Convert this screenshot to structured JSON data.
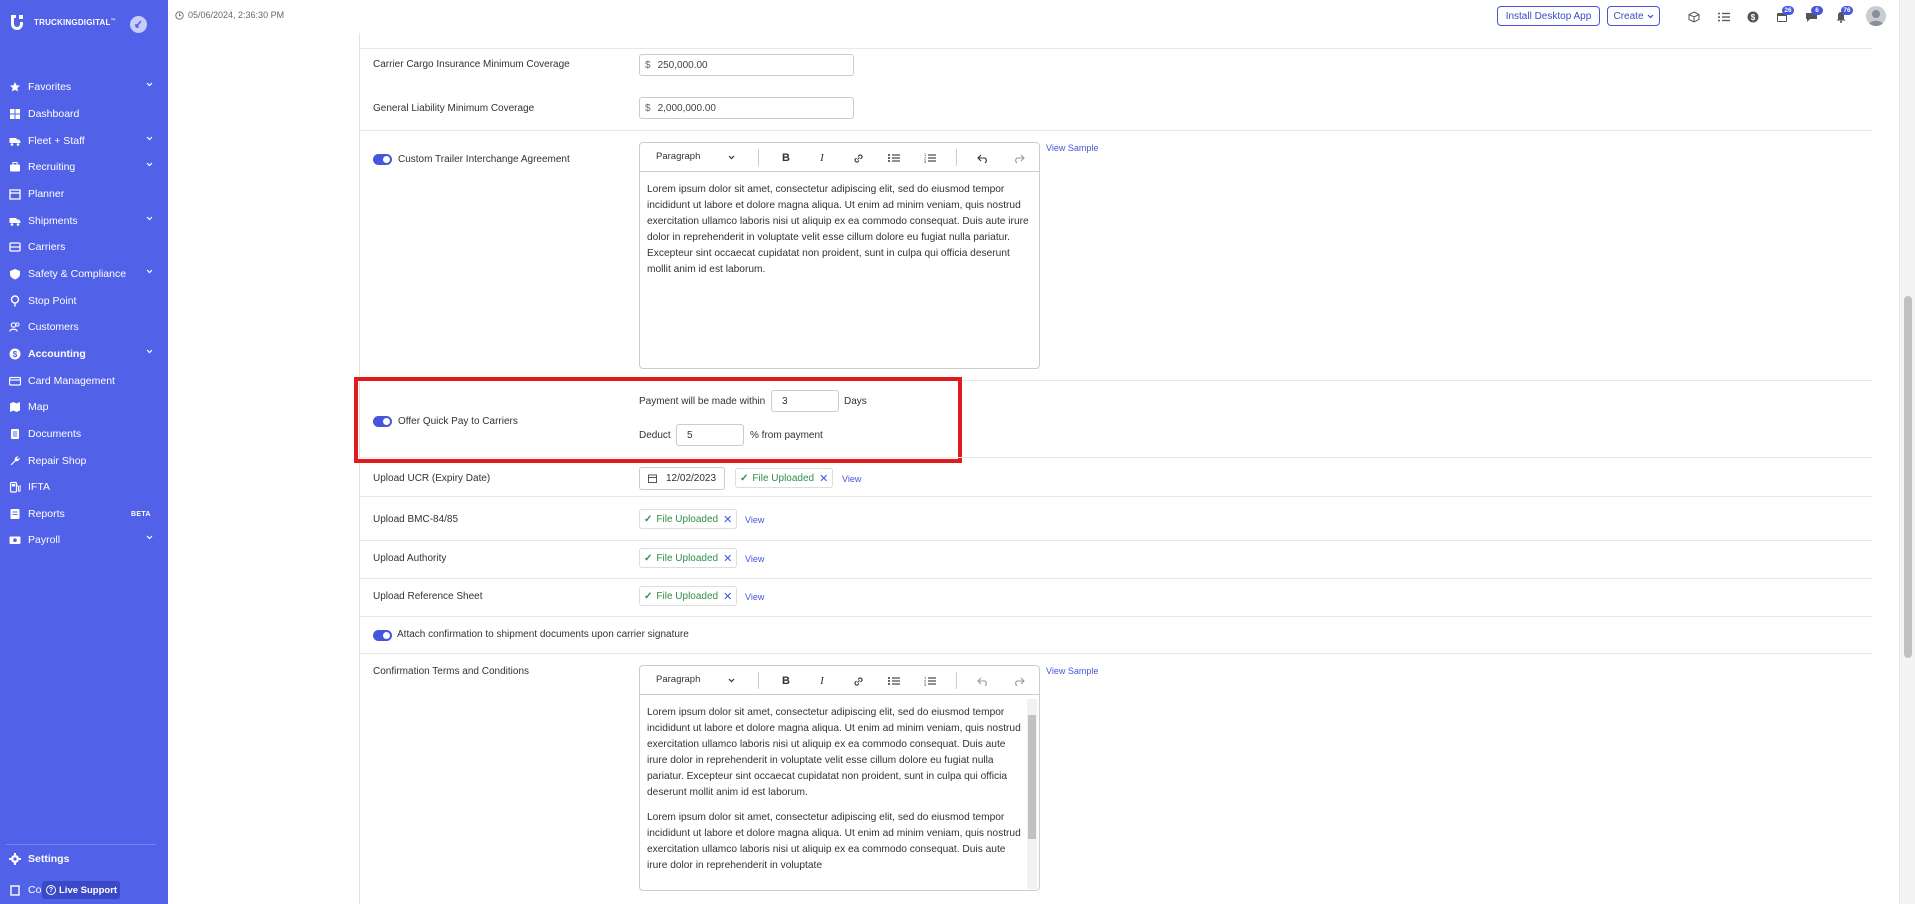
{
  "app": {
    "brand": "TRUCKINGDIGITAL",
    "brand_tm": "™"
  },
  "header": {
    "datetime": "05/06/2024, 2:36:30 PM",
    "install_label": "Install Desktop App",
    "create_label": "Create",
    "badges": {
      "calendar": "26",
      "chat": "6",
      "bell": "76"
    }
  },
  "sidebar": {
    "items": [
      {
        "label": "Favorites",
        "icon": "star-icon",
        "chevron": true
      },
      {
        "label": "Dashboard",
        "icon": "dashboard-icon",
        "chevron": false
      },
      {
        "label": "Fleet + Staff",
        "icon": "truck-icon",
        "chevron": true
      },
      {
        "label": "Recruiting",
        "icon": "briefcase-icon",
        "chevron": true
      },
      {
        "label": "Planner",
        "icon": "planner-icon",
        "chevron": false
      },
      {
        "label": "Shipments",
        "icon": "shipment-icon",
        "chevron": true
      },
      {
        "label": "Carriers",
        "icon": "carrier-icon",
        "chevron": false
      },
      {
        "label": "Safety & Compliance",
        "icon": "shield-icon",
        "chevron": true
      },
      {
        "label": "Stop Point",
        "icon": "pin-icon",
        "chevron": false
      },
      {
        "label": "Customers",
        "icon": "users-icon",
        "chevron": false
      },
      {
        "label": "Accounting",
        "icon": "dollar-icon",
        "chevron": true,
        "active": true
      },
      {
        "label": "Card Management",
        "icon": "card-icon",
        "chevron": false
      },
      {
        "label": "Map",
        "icon": "map-icon",
        "chevron": false
      },
      {
        "label": "Documents",
        "icon": "document-icon",
        "chevron": false
      },
      {
        "label": "Repair Shop",
        "icon": "wrench-icon",
        "chevron": false
      },
      {
        "label": "IFTA",
        "icon": "fuel-icon",
        "chevron": false
      },
      {
        "label": "Reports",
        "icon": "reports-icon",
        "chevron": false,
        "badge": "BETA"
      },
      {
        "label": "Payroll",
        "icon": "payroll-icon",
        "chevron": true
      }
    ],
    "settings_label": "Settings",
    "bottom_partial_label": "Co",
    "live_support_label": "Live Support"
  },
  "form": {
    "cargo": {
      "label": "Carrier Cargo Insurance Minimum Coverage",
      "currency": "$",
      "value": "250,000.00"
    },
    "liability": {
      "label": "General Liability Minimum Coverage",
      "currency": "$",
      "value": "2,000,000.00"
    },
    "trailer": {
      "label": "Custom Trailer Interchange Agreement",
      "enabled": true,
      "format": "Paragraph",
      "view_sample": "View Sample",
      "text": "Lorem ipsum dolor sit amet, consectetur adipiscing elit, sed do eiusmod tempor incididunt ut labore et dolore magna aliqua. Ut enim ad minim veniam, quis nostrud exercitation ullamco laboris nisi ut aliquip ex ea commodo consequat. Duis aute irure dolor in reprehenderit in voluptate velit esse cillum dolore eu fugiat nulla pariatur. Excepteur sint occaecat cupidatat non proident, sunt in culpa qui officia deserunt mollit anim id est laborum."
    },
    "quickpay": {
      "label": "Offer Quick Pay to Carriers",
      "enabled": true,
      "payment_prefix": "Payment will be made within",
      "days_value": "3",
      "days_suffix": "Days",
      "deduct_prefix": "Deduct",
      "deduct_value": "5",
      "deduct_suffix": "% from payment"
    },
    "ucr": {
      "label": "Upload UCR (Expiry Date)",
      "date": "12/02/2023",
      "chip": "File Uploaded",
      "view": "View"
    },
    "bmc": {
      "label": "Upload BMC-84/85",
      "chip": "File Uploaded",
      "view": "View"
    },
    "authority": {
      "label": "Upload Authority",
      "chip": "File Uploaded",
      "view": "View"
    },
    "reference": {
      "label": "Upload Reference Sheet",
      "chip": "File Uploaded",
      "view": "View"
    },
    "attach": {
      "label": "Attach confirmation to shipment documents upon carrier signature",
      "enabled": true
    },
    "terms": {
      "label": "Confirmation Terms and Conditions",
      "format": "Paragraph",
      "view_sample": "View Sample",
      "para1": "Lorem ipsum dolor sit amet, consectetur adipiscing elit, sed do eiusmod tempor incididunt ut labore et dolore magna aliqua. Ut enim ad minim veniam, quis nostrud exercitation ullamco laboris nisi ut aliquip ex ea commodo consequat. Duis aute irure dolor in reprehenderit in voluptate velit esse cillum dolore eu fugiat nulla pariatur. Excepteur sint occaecat cupidatat non proident, sunt in culpa qui officia deserunt mollit anim id est laborum.",
      "para2": "Lorem ipsum dolor sit amet, consectetur adipiscing elit, sed do eiusmod tempor incididunt ut labore et dolore magna aliqua. Ut enim ad minim veniam, quis nostrud exercitation ullamco laboris nisi ut aliquip ex ea commodo consequat. Duis aute irure dolor in reprehenderit in voluptate"
    }
  },
  "colors": {
    "sidebar": "#5161e8",
    "accent": "#4556dd",
    "highlight": "#e01b1b",
    "success": "#2f8f46"
  }
}
